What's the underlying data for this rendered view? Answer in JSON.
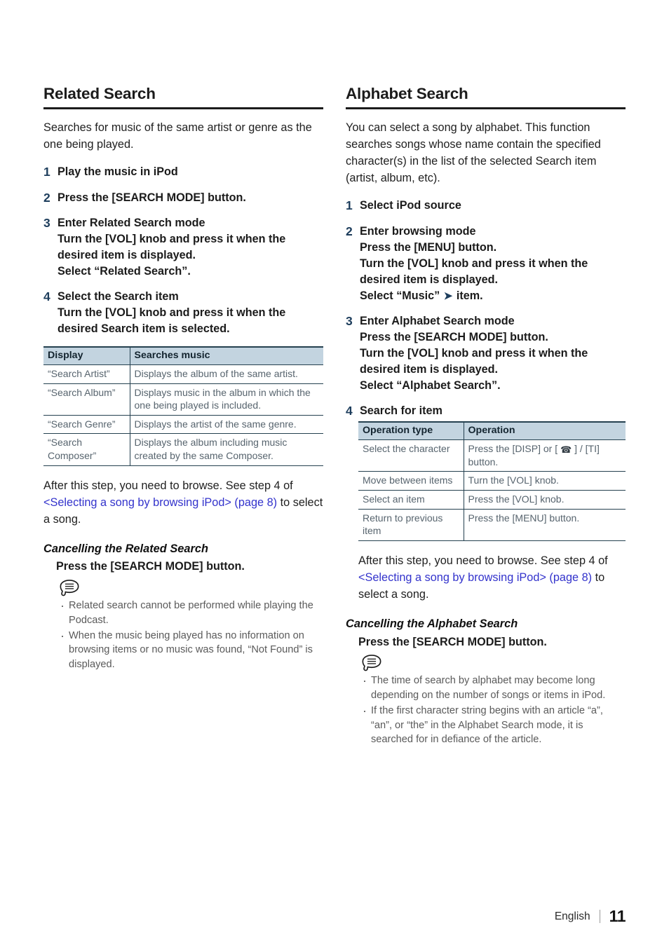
{
  "document": {
    "footer": {
      "language": "English",
      "page_number": "11"
    }
  },
  "left_column": {
    "heading": "Related Search",
    "intro": "Searches for music of the same artist or genre as the one being played.",
    "steps": [
      {
        "number": "1",
        "lead": "Play the music in iPod",
        "sub_lines": []
      },
      {
        "number": "2",
        "lead": "Press the [SEARCH MODE] button.",
        "sub_lines": []
      },
      {
        "number": "3",
        "lead": "Enter Related Search mode",
        "sub_lines": [
          "Turn the [VOL] knob and press it when the desired item is displayed.",
          "Select “Related Search”."
        ]
      },
      {
        "number": "4",
        "lead": "Select the Search item",
        "sub_lines": [
          "Turn the [VOL] knob and press it when the desired Search item is selected."
        ]
      }
    ],
    "table": {
      "headers": [
        "Display",
        "Searches music"
      ],
      "rows": [
        [
          "“Search Artist”",
          "Displays the album of the same artist."
        ],
        [
          "“Search Album”",
          "Displays music in the album in which the one being played is included."
        ],
        [
          "“Search Genre”",
          "Displays the artist of the same genre."
        ],
        [
          "“Search Composer”",
          "Displays the album including music created by the same Composer."
        ]
      ]
    },
    "after_note": {
      "before_link": "After this step, you need to browse. See step 4 of ",
      "link_text": "<Selecting a song by browsing iPod> (page 8)",
      "after_link": " to select a song."
    },
    "cancel": {
      "title": "Cancelling the Related Search",
      "instruction": "Press the [SEARCH MODE] button."
    },
    "notes": [
      "Related search cannot be performed while playing the Podcast.",
      "When the music being played has no information on browsing items or no music was found, “Not Found” is displayed."
    ]
  },
  "right_column": {
    "heading": "Alphabet Search",
    "intro": "You can select a song by alphabet. This function searches songs whose name contain the specified character(s) in the list of the selected Search item (artist, album, etc).",
    "steps": [
      {
        "number": "1",
        "lead": "Select iPod source",
        "sub_lines": []
      },
      {
        "number": "2",
        "lead": "Enter browsing mode",
        "sub_lines": [
          "Press the [MENU] button.",
          "Turn the [VOL] knob and press it when the desired item is displayed."
        ],
        "final_line_parts": {
          "before_arrow": "Select “Music” ",
          "arrow": "➤",
          "after_arrow": " item."
        }
      },
      {
        "number": "3",
        "lead": "Enter Alphabet Search mode",
        "sub_lines": [
          "Press the [SEARCH MODE] button.",
          "Turn the [VOL] knob and press it when the desired item is displayed.",
          "Select “Alphabet Search”."
        ]
      },
      {
        "number": "4",
        "lead": "Search for item",
        "sub_lines": []
      }
    ],
    "table": {
      "headers": [
        "Operation type",
        "Operation"
      ],
      "rows": [
        {
          "type": "Select the character",
          "operation_before_phone": "Press the [DISP] or [ ",
          "operation_phone_icon": "☎",
          "operation_after_phone": " ] / [TI] button."
        },
        {
          "type": "Move between items",
          "operation": "Turn the [VOL] knob."
        },
        {
          "type": "Select an item",
          "operation": "Press the [VOL] knob."
        },
        {
          "type": "Return to previous item",
          "operation": "Press the [MENU] button."
        }
      ]
    },
    "after_note": {
      "before_link": "After this step, you need to browse. See step 4 of ",
      "link_text": "<Selecting a song by browsing iPod> (page 8)",
      "after_link": " to select a song."
    },
    "cancel": {
      "title": "Cancelling the Alphabet Search",
      "instruction": "Press the [SEARCH MODE] button."
    },
    "notes": [
      "The time of search by alphabet may become long depending on the number of songs or items in iPod.",
      "If the first character string begins with an article “a”, “an”, or “the” in the Alphabet Search mode, it is searched for in defiance of the article."
    ]
  },
  "colors": {
    "step_number": "#1d3d5c",
    "link": "#3333cc",
    "table_header_fill": "#c3d4e0",
    "table_rule": "#24404f",
    "note_text": "#5a5a5a"
  }
}
